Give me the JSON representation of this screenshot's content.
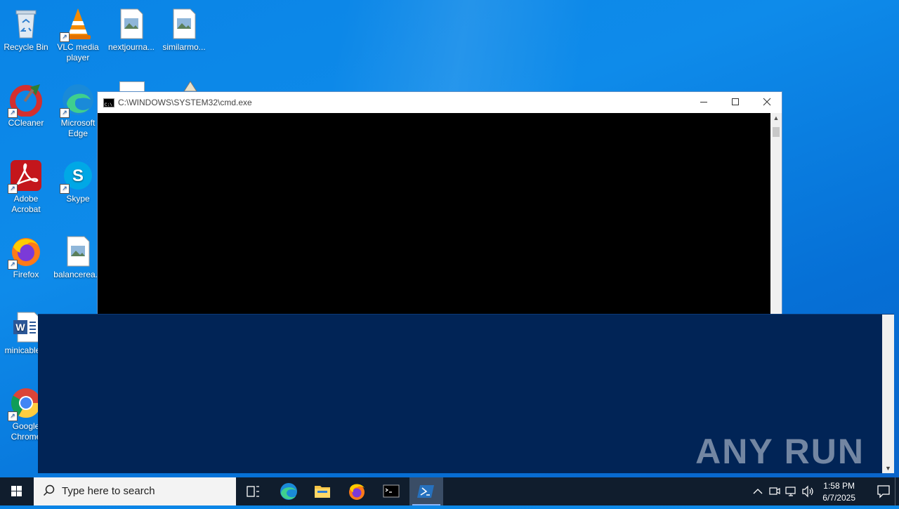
{
  "desktop": {
    "icons": [
      {
        "label": "Recycle Bin"
      },
      {
        "label": "VLC media player"
      },
      {
        "label": "nextjourna..."
      },
      {
        "label": "similarmo..."
      },
      {
        "label": "CCleaner"
      },
      {
        "label": "Microsoft Edge"
      },
      {
        "label": "Adobe Acrobat"
      },
      {
        "label": "Skype"
      },
      {
        "label": "Firefox"
      },
      {
        "label": "balancerea..."
      },
      {
        "label": "minicable..."
      },
      {
        "label": "Google Chrome"
      }
    ]
  },
  "cmd_window": {
    "title": "C:\\WINDOWS\\SYSTEM32\\cmd.exe"
  },
  "watermark": "ANY RUN",
  "taskbar": {
    "search_placeholder": "Type here to search",
    "time": "1:58 PM",
    "date": "6/7/2025"
  },
  "colors": {
    "desktop": "#0a84e6",
    "console": "#000000",
    "powershell": "#012456",
    "taskbar": "#101d2d"
  }
}
